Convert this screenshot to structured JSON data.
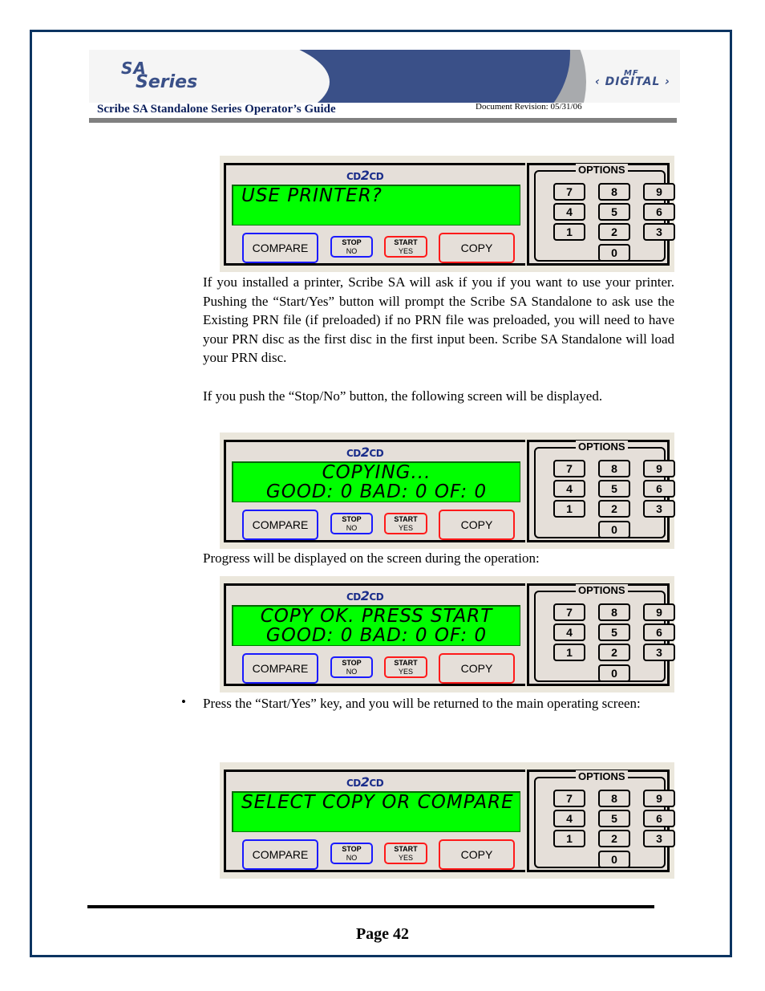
{
  "header": {
    "logo_left_line1": "SA",
    "logo_left_line2": "Series",
    "logo_right_small": "MF",
    "logo_right": "DIGITAL",
    "title": "Scribe SA Standalone Series Operator’s Guide",
    "revision": "Document Revision: 05/31/06"
  },
  "panel_common": {
    "brand_left": "CD",
    "brand_mid": "2",
    "brand_right": "CD",
    "compare": "COMPARE",
    "stop_top": "STOP",
    "stop_bottom": "NO",
    "start_top": "START",
    "start_bottom": "YES",
    "copy": "COPY",
    "options": "OPTIONS",
    "keys": [
      "7",
      "8",
      "9",
      "4",
      "5",
      "6",
      "1",
      "2",
      "3",
      "0"
    ]
  },
  "screens": [
    {
      "line1": "USE PRINTER?",
      "line2": ""
    },
    {
      "line1": "COPYING...",
      "line2": "GOOD: 0  BAD: 0  OF: 0"
    },
    {
      "line1": "COPY OK. PRESS START",
      "line2": "GOOD: 0  BAD: 0  OF: 0"
    },
    {
      "line1": "SELECT COPY OR COMPARE",
      "line2": ""
    }
  ],
  "body": {
    "para1": "If you installed a printer, Scribe SA will ask if you if you want to use your printer.  Pushing the “Start/Yes” button will prompt the Scribe SA Standalone to ask use the Existing PRN file (if preloaded) if no PRN file was preloaded, you will need to have your PRN disc as the first disc in the first input been.  Scribe SA Standalone will load your PRN disc.",
    "para2": "If you push the “Stop/No” button, the following screen will be displayed.",
    "para3": "Progress will be displayed on the screen during the operation:",
    "bullet": "•",
    "para4": "Press the “Start/Yes” key, and you will be returned to the main operating screen:"
  },
  "footer": {
    "page": "Page 42"
  }
}
